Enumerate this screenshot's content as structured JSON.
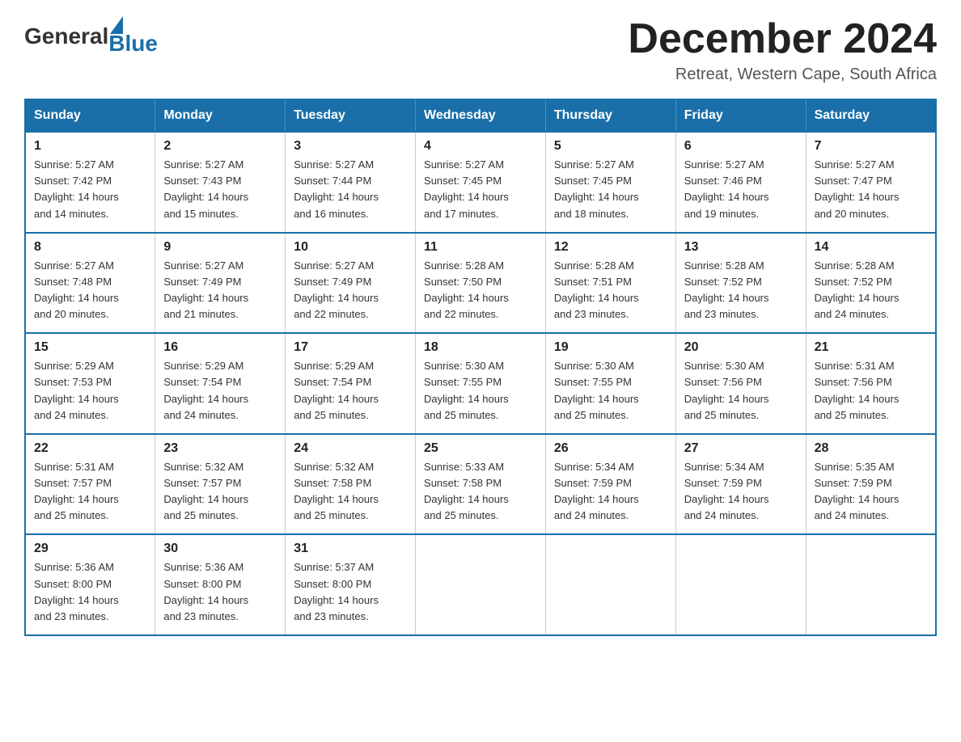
{
  "header": {
    "logo_general": "General",
    "logo_blue": "Blue",
    "month_title": "December 2024",
    "location": "Retreat, Western Cape, South Africa"
  },
  "days_of_week": [
    "Sunday",
    "Monday",
    "Tuesday",
    "Wednesday",
    "Thursday",
    "Friday",
    "Saturday"
  ],
  "weeks": [
    [
      {
        "day": "1",
        "sunrise": "5:27 AM",
        "sunset": "7:42 PM",
        "daylight": "14 hours and 14 minutes."
      },
      {
        "day": "2",
        "sunrise": "5:27 AM",
        "sunset": "7:43 PM",
        "daylight": "14 hours and 15 minutes."
      },
      {
        "day": "3",
        "sunrise": "5:27 AM",
        "sunset": "7:44 PM",
        "daylight": "14 hours and 16 minutes."
      },
      {
        "day": "4",
        "sunrise": "5:27 AM",
        "sunset": "7:45 PM",
        "daylight": "14 hours and 17 minutes."
      },
      {
        "day": "5",
        "sunrise": "5:27 AM",
        "sunset": "7:45 PM",
        "daylight": "14 hours and 18 minutes."
      },
      {
        "day": "6",
        "sunrise": "5:27 AM",
        "sunset": "7:46 PM",
        "daylight": "14 hours and 19 minutes."
      },
      {
        "day": "7",
        "sunrise": "5:27 AM",
        "sunset": "7:47 PM",
        "daylight": "14 hours and 20 minutes."
      }
    ],
    [
      {
        "day": "8",
        "sunrise": "5:27 AM",
        "sunset": "7:48 PM",
        "daylight": "14 hours and 20 minutes."
      },
      {
        "day": "9",
        "sunrise": "5:27 AM",
        "sunset": "7:49 PM",
        "daylight": "14 hours and 21 minutes."
      },
      {
        "day": "10",
        "sunrise": "5:27 AM",
        "sunset": "7:49 PM",
        "daylight": "14 hours and 22 minutes."
      },
      {
        "day": "11",
        "sunrise": "5:28 AM",
        "sunset": "7:50 PM",
        "daylight": "14 hours and 22 minutes."
      },
      {
        "day": "12",
        "sunrise": "5:28 AM",
        "sunset": "7:51 PM",
        "daylight": "14 hours and 23 minutes."
      },
      {
        "day": "13",
        "sunrise": "5:28 AM",
        "sunset": "7:52 PM",
        "daylight": "14 hours and 23 minutes."
      },
      {
        "day": "14",
        "sunrise": "5:28 AM",
        "sunset": "7:52 PM",
        "daylight": "14 hours and 24 minutes."
      }
    ],
    [
      {
        "day": "15",
        "sunrise": "5:29 AM",
        "sunset": "7:53 PM",
        "daylight": "14 hours and 24 minutes."
      },
      {
        "day": "16",
        "sunrise": "5:29 AM",
        "sunset": "7:54 PM",
        "daylight": "14 hours and 24 minutes."
      },
      {
        "day": "17",
        "sunrise": "5:29 AM",
        "sunset": "7:54 PM",
        "daylight": "14 hours and 25 minutes."
      },
      {
        "day": "18",
        "sunrise": "5:30 AM",
        "sunset": "7:55 PM",
        "daylight": "14 hours and 25 minutes."
      },
      {
        "day": "19",
        "sunrise": "5:30 AM",
        "sunset": "7:55 PM",
        "daylight": "14 hours and 25 minutes."
      },
      {
        "day": "20",
        "sunrise": "5:30 AM",
        "sunset": "7:56 PM",
        "daylight": "14 hours and 25 minutes."
      },
      {
        "day": "21",
        "sunrise": "5:31 AM",
        "sunset": "7:56 PM",
        "daylight": "14 hours and 25 minutes."
      }
    ],
    [
      {
        "day": "22",
        "sunrise": "5:31 AM",
        "sunset": "7:57 PM",
        "daylight": "14 hours and 25 minutes."
      },
      {
        "day": "23",
        "sunrise": "5:32 AM",
        "sunset": "7:57 PM",
        "daylight": "14 hours and 25 minutes."
      },
      {
        "day": "24",
        "sunrise": "5:32 AM",
        "sunset": "7:58 PM",
        "daylight": "14 hours and 25 minutes."
      },
      {
        "day": "25",
        "sunrise": "5:33 AM",
        "sunset": "7:58 PM",
        "daylight": "14 hours and 25 minutes."
      },
      {
        "day": "26",
        "sunrise": "5:34 AM",
        "sunset": "7:59 PM",
        "daylight": "14 hours and 24 minutes."
      },
      {
        "day": "27",
        "sunrise": "5:34 AM",
        "sunset": "7:59 PM",
        "daylight": "14 hours and 24 minutes."
      },
      {
        "day": "28",
        "sunrise": "5:35 AM",
        "sunset": "7:59 PM",
        "daylight": "14 hours and 24 minutes."
      }
    ],
    [
      {
        "day": "29",
        "sunrise": "5:36 AM",
        "sunset": "8:00 PM",
        "daylight": "14 hours and 23 minutes."
      },
      {
        "day": "30",
        "sunrise": "5:36 AM",
        "sunset": "8:00 PM",
        "daylight": "14 hours and 23 minutes."
      },
      {
        "day": "31",
        "sunrise": "5:37 AM",
        "sunset": "8:00 PM",
        "daylight": "14 hours and 23 minutes."
      },
      null,
      null,
      null,
      null
    ]
  ],
  "labels": {
    "sunrise": "Sunrise:",
    "sunset": "Sunset:",
    "daylight": "Daylight:"
  }
}
